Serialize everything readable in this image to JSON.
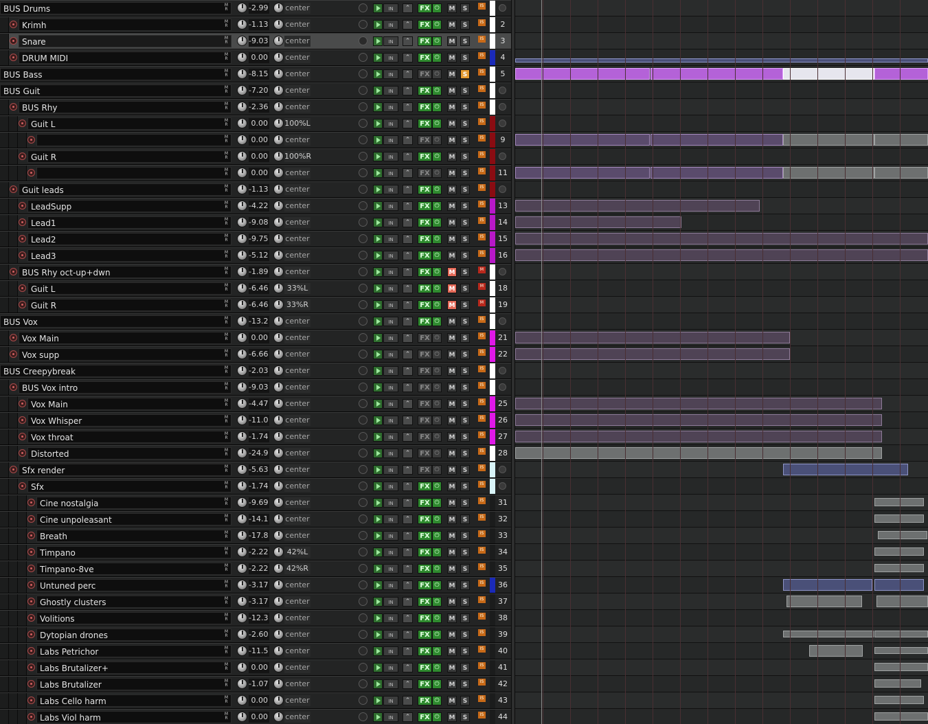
{
  "tracks": [
    {
      "num": "",
      "name": "BUS Drums",
      "indent": 0,
      "rec": false,
      "vol": "-2.99",
      "pan": "center",
      "fx": true,
      "mute": false,
      "solo": false,
      "color": "#ffffff",
      "io": "IS",
      "numVisible": false
    },
    {
      "num": "2",
      "name": "Krimh",
      "indent": 1,
      "rec": true,
      "vol": "-1.13",
      "pan": "center",
      "fx": true,
      "mute": false,
      "solo": false,
      "color": "#ffffff",
      "io": "IS"
    },
    {
      "num": "3",
      "name": "Snare",
      "indent": 1,
      "rec": true,
      "vol": "-9.03",
      "pan": "center",
      "fx": true,
      "mute": false,
      "solo": false,
      "color": "#ffffff",
      "io": "IS",
      "selected": true
    },
    {
      "num": "4",
      "name": "DRUM MIDI",
      "indent": 1,
      "rec": true,
      "vol": "0.00",
      "pan": "center",
      "fx": true,
      "mute": false,
      "solo": false,
      "color": "#1a2ab8",
      "io": "IS"
    },
    {
      "num": "5",
      "name": "BUS Bass",
      "indent": 0,
      "rec": false,
      "vol": "-8.15",
      "pan": "center",
      "fx": false,
      "mute": false,
      "solo": true,
      "color": "#ffffff",
      "io": "IS"
    },
    {
      "num": "",
      "name": "BUS Guit",
      "indent": 0,
      "rec": false,
      "vol": "-7.20",
      "pan": "center",
      "fx": true,
      "mute": false,
      "solo": false,
      "color": "#ffffff",
      "io": "IS"
    },
    {
      "num": "",
      "name": "BUS Rhy",
      "indent": 1,
      "rec": true,
      "vol": "-2.36",
      "pan": "center",
      "fx": true,
      "mute": false,
      "solo": false,
      "color": "#ffffff",
      "io": "IS"
    },
    {
      "num": "",
      "name": "Guit L",
      "indent": 2,
      "rec": true,
      "vol": "0.00",
      "pan": "100%L",
      "fx": true,
      "mute": false,
      "solo": false,
      "color": "#8a0c12",
      "io": "IS"
    },
    {
      "num": "9",
      "name": "",
      "indent": 3,
      "rec": true,
      "vol": "0.00",
      "pan": "center",
      "fx": false,
      "mute": false,
      "solo": false,
      "color": "#8a0c12",
      "io": "IS"
    },
    {
      "num": "",
      "name": "Guit R",
      "indent": 2,
      "rec": true,
      "vol": "0.00",
      "pan": "100%R",
      "fx": true,
      "mute": false,
      "solo": false,
      "color": "#8a0c12",
      "io": "IS"
    },
    {
      "num": "11",
      "name": "",
      "indent": 3,
      "rec": true,
      "vol": "0.00",
      "pan": "center",
      "fx": false,
      "mute": false,
      "solo": false,
      "color": "#8a0c12",
      "io": "IS"
    },
    {
      "num": "",
      "name": "Guit leads",
      "indent": 1,
      "rec": true,
      "vol": "-1.13",
      "pan": "center",
      "fx": true,
      "mute": false,
      "solo": false,
      "color": "#8a0c12",
      "io": "IS"
    },
    {
      "num": "13",
      "name": "LeadSupp",
      "indent": 2,
      "rec": true,
      "vol": "-4.22",
      "pan": "center",
      "fx": true,
      "mute": false,
      "solo": false,
      "color": "#b818c8",
      "io": "IS"
    },
    {
      "num": "14",
      "name": "Lead1",
      "indent": 2,
      "rec": true,
      "vol": "-9.08",
      "pan": "center",
      "fx": true,
      "mute": false,
      "solo": false,
      "color": "#b818c8",
      "io": "IS"
    },
    {
      "num": "15",
      "name": "Lead2",
      "indent": 2,
      "rec": true,
      "vol": "-9.75",
      "pan": "center",
      "fx": true,
      "mute": false,
      "solo": false,
      "color": "#b818c8",
      "io": "IS"
    },
    {
      "num": "16",
      "name": "Lead3",
      "indent": 2,
      "rec": true,
      "vol": "-5.12",
      "pan": "center",
      "fx": true,
      "mute": false,
      "solo": false,
      "color": "#b818c8",
      "io": "IS"
    },
    {
      "num": "",
      "name": "BUS Rhy oct-up+dwn",
      "indent": 1,
      "rec": true,
      "vol": "-1.89",
      "pan": "center",
      "fx": true,
      "mute": true,
      "solo": false,
      "color": "#ffffff",
      "io": "M"
    },
    {
      "num": "18",
      "name": "Guit L",
      "indent": 2,
      "rec": true,
      "vol": "-6.46",
      "pan": "33%L",
      "fx": true,
      "mute": true,
      "solo": false,
      "color": "#ffffff",
      "io": "M"
    },
    {
      "num": "19",
      "name": "Guit R",
      "indent": 2,
      "rec": true,
      "vol": "-6.46",
      "pan": "33%R",
      "fx": true,
      "mute": true,
      "solo": false,
      "color": "#ffffff",
      "io": "M"
    },
    {
      "num": "",
      "name": "BUS Vox",
      "indent": 0,
      "rec": false,
      "vol": "-13.2",
      "pan": "center",
      "fx": true,
      "mute": false,
      "solo": false,
      "color": "#ffffff",
      "io": "IS"
    },
    {
      "num": "21",
      "name": "Vox Main",
      "indent": 1,
      "rec": true,
      "vol": "0.00",
      "pan": "center",
      "fx": false,
      "mute": false,
      "solo": false,
      "color": "#e018e8",
      "io": "IS"
    },
    {
      "num": "22",
      "name": "Vox supp",
      "indent": 1,
      "rec": true,
      "vol": "-6.66",
      "pan": "center",
      "fx": false,
      "mute": false,
      "solo": false,
      "color": "#e018e8",
      "io": "IS"
    },
    {
      "num": "",
      "name": "BUS Creepybreak",
      "indent": 0,
      "rec": false,
      "vol": "-2.03",
      "pan": "center",
      "fx": false,
      "mute": false,
      "solo": false,
      "color": "#ffffff",
      "io": "IS"
    },
    {
      "num": "",
      "name": "BUS Vox intro",
      "indent": 1,
      "rec": true,
      "vol": "-9.03",
      "pan": "center",
      "fx": false,
      "mute": false,
      "solo": false,
      "color": "#ffffff",
      "io": "IS"
    },
    {
      "num": "25",
      "name": "Vox Main",
      "indent": 2,
      "rec": true,
      "vol": "-4.47",
      "pan": "center",
      "fx": false,
      "mute": false,
      "solo": false,
      "color": "#e018e8",
      "io": "IS"
    },
    {
      "num": "26",
      "name": "Vox Whisper",
      "indent": 2,
      "rec": true,
      "vol": "-11.0",
      "pan": "center",
      "fx": false,
      "mute": false,
      "solo": false,
      "color": "#e018e8",
      "io": "IS"
    },
    {
      "num": "27",
      "name": "Vox throat",
      "indent": 2,
      "rec": true,
      "vol": "-1.74",
      "pan": "center",
      "fx": false,
      "mute": false,
      "solo": false,
      "color": "#e018e8",
      "io": "IS"
    },
    {
      "num": "28",
      "name": "Distorted",
      "indent": 2,
      "rec": true,
      "vol": "-24.9",
      "pan": "center",
      "fx": false,
      "mute": false,
      "solo": false,
      "color": "#ffffff",
      "io": "IS"
    },
    {
      "num": "",
      "name": "Sfx render",
      "indent": 1,
      "rec": true,
      "vol": "-5.63",
      "pan": "center",
      "fx": false,
      "mute": false,
      "solo": false,
      "color": "#d8f4f8",
      "io": "IS"
    },
    {
      "num": "",
      "name": "Sfx",
      "indent": 2,
      "rec": true,
      "vol": "-1.74",
      "pan": "center",
      "fx": true,
      "mute": false,
      "solo": false,
      "color": "#d8f4f8",
      "io": "IS"
    },
    {
      "num": "31",
      "name": "Cine nostalgia",
      "indent": 3,
      "rec": true,
      "vol": "-9.69",
      "pan": "center",
      "fx": true,
      "mute": false,
      "solo": false,
      "color": "#1b1c1c",
      "io": "IS"
    },
    {
      "num": "32",
      "name": "Cine unpoleasant",
      "indent": 3,
      "rec": true,
      "vol": "-14.1",
      "pan": "center",
      "fx": true,
      "mute": false,
      "solo": false,
      "color": "#1b1c1c",
      "io": "IS"
    },
    {
      "num": "33",
      "name": "Breath",
      "indent": 3,
      "rec": true,
      "vol": "-17.8",
      "pan": "center",
      "fx": true,
      "mute": false,
      "solo": false,
      "color": "#1b1c1c",
      "io": "IS"
    },
    {
      "num": "34",
      "name": "Timpano",
      "indent": 3,
      "rec": true,
      "vol": "-2.22",
      "pan": "42%L",
      "fx": true,
      "mute": false,
      "solo": false,
      "color": "#1b1c1c",
      "io": "IS"
    },
    {
      "num": "35",
      "name": "Timpano-8ve",
      "indent": 3,
      "rec": true,
      "vol": "-2.22",
      "pan": "42%R",
      "fx": true,
      "mute": false,
      "solo": false,
      "color": "#1b1c1c",
      "io": "IS"
    },
    {
      "num": "36",
      "name": "Untuned perc",
      "indent": 3,
      "rec": true,
      "vol": "-3.17",
      "pan": "center",
      "fx": true,
      "mute": false,
      "solo": false,
      "color": "#1a2ab8",
      "io": "IS"
    },
    {
      "num": "37",
      "name": "Ghostly clusters",
      "indent": 3,
      "rec": true,
      "vol": "-3.17",
      "pan": "center",
      "fx": true,
      "mute": false,
      "solo": false,
      "color": "#1b1c1c",
      "io": "IS"
    },
    {
      "num": "38",
      "name": "Volitions",
      "indent": 3,
      "rec": true,
      "vol": "-12.3",
      "pan": "center",
      "fx": true,
      "mute": false,
      "solo": false,
      "color": "#1b1c1c",
      "io": "IS"
    },
    {
      "num": "39",
      "name": "Dytopian drones",
      "indent": 3,
      "rec": true,
      "vol": "-2.60",
      "pan": "center",
      "fx": true,
      "mute": false,
      "solo": false,
      "color": "#1b1c1c",
      "io": "IS"
    },
    {
      "num": "40",
      "name": "Labs Petrichor",
      "indent": 3,
      "rec": true,
      "vol": "-11.5",
      "pan": "center",
      "fx": true,
      "mute": false,
      "solo": false,
      "color": "#1b1c1c",
      "io": "IS"
    },
    {
      "num": "41",
      "name": "Labs Brutalizer+",
      "indent": 3,
      "rec": true,
      "vol": "0.00",
      "pan": "center",
      "fx": true,
      "mute": false,
      "solo": false,
      "color": "#1b1c1c",
      "io": "IS"
    },
    {
      "num": "42",
      "name": "Labs Brutalizer",
      "indent": 3,
      "rec": true,
      "vol": "-1.07",
      "pan": "center",
      "fx": true,
      "mute": false,
      "solo": false,
      "color": "#1b1c1c",
      "io": "IS"
    },
    {
      "num": "43",
      "name": "Labs Cello harm",
      "indent": 3,
      "rec": true,
      "vol": "0.00",
      "pan": "center",
      "fx": true,
      "mute": false,
      "solo": false,
      "color": "#1b1c1c",
      "io": "IS"
    },
    {
      "num": "44",
      "name": "Labs Viol harm",
      "indent": 3,
      "rec": true,
      "vol": "0.00",
      "pan": "center",
      "fx": true,
      "mute": false,
      "solo": false,
      "color": "#1b1c1c",
      "io": "IS"
    }
  ],
  "labels": {
    "input_label": "IN",
    "fx_label": "FX",
    "mute_label": "M",
    "solo_label": "S",
    "midi_r": "R",
    "midi_m": "M"
  },
  "icons": {
    "record_arm": "record-arm-icon",
    "play": "play-icon",
    "automation": "envelope-icon",
    "fx_power": "power-icon",
    "io": "routing-icon"
  },
  "colors": {
    "grid": "#4a2f33",
    "fx_on": "#2f8a2f",
    "mute_on": "#e46a58",
    "solo_on": "#e49a30"
  }
}
